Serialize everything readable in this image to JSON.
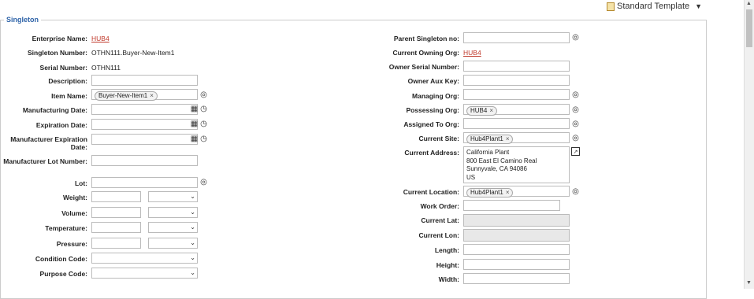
{
  "header": {
    "template_label": "Standard Template"
  },
  "section": {
    "title": "Singleton"
  },
  "left": {
    "enterprise_name": {
      "label": "Enterprise Name:",
      "value": "HUB4"
    },
    "singleton_number": {
      "label": "Singleton Number:",
      "value": "OTHN111.Buyer-New-Item1"
    },
    "serial_number": {
      "label": "Serial Number:",
      "value": "OTHN111"
    },
    "description": {
      "label": "Description:"
    },
    "item_name": {
      "label": "Item Name:",
      "value": "Buyer-New-Item1"
    },
    "manufacturing_date": {
      "label": "Manufacturing Date:"
    },
    "expiration_date": {
      "label": "Expiration Date:"
    },
    "manufacturer_expiration_date": {
      "label": "Manufacturer Expiration Date:"
    },
    "manufacturer_lot_number": {
      "label": "Manufacturer Lot Number:"
    },
    "lot": {
      "label": "Lot:"
    },
    "weight": {
      "label": "Weight:"
    },
    "volume": {
      "label": "Volume:"
    },
    "temperature": {
      "label": "Temperature:"
    },
    "pressure": {
      "label": "Pressure:"
    },
    "condition_code": {
      "label": "Condition Code:"
    },
    "purpose_code": {
      "label": "Purpose Code:"
    }
  },
  "right": {
    "parent_singleton_no": {
      "label": "Parent Singleton no:"
    },
    "current_owning_org": {
      "label": "Current Owning Org:",
      "value": "HUB4"
    },
    "owner_serial_number": {
      "label": "Owner Serial Number:"
    },
    "owner_aux_key": {
      "label": "Owner Aux Key:"
    },
    "managing_org": {
      "label": "Managing Org:"
    },
    "possessing_org": {
      "label": "Possessing Org:",
      "value": "HUB4"
    },
    "assigned_to_org": {
      "label": "Assigned To Org:"
    },
    "current_site": {
      "label": "Current Site:",
      "value": "Hub4Plant1"
    },
    "current_address": {
      "label": "Current Address:",
      "lines": [
        "California Plant",
        "800 East El Camino Real",
        "Sunnyvale, CA 94086",
        "US"
      ]
    },
    "current_location": {
      "label": "Current Location:",
      "value": "Hub4Plant1"
    },
    "work_order": {
      "label": "Work Order:"
    },
    "current_lat": {
      "label": "Current Lat:"
    },
    "current_lon": {
      "label": "Current Lon:"
    },
    "length": {
      "label": "Length:"
    },
    "height": {
      "label": "Height:"
    },
    "width": {
      "label": "Width:"
    }
  },
  "icons": {
    "search": "magnifier-icon",
    "calendar": "calendar-icon",
    "clock": "clock-icon",
    "remove": "×",
    "caret": "▼",
    "pick": "address-picker-icon"
  }
}
